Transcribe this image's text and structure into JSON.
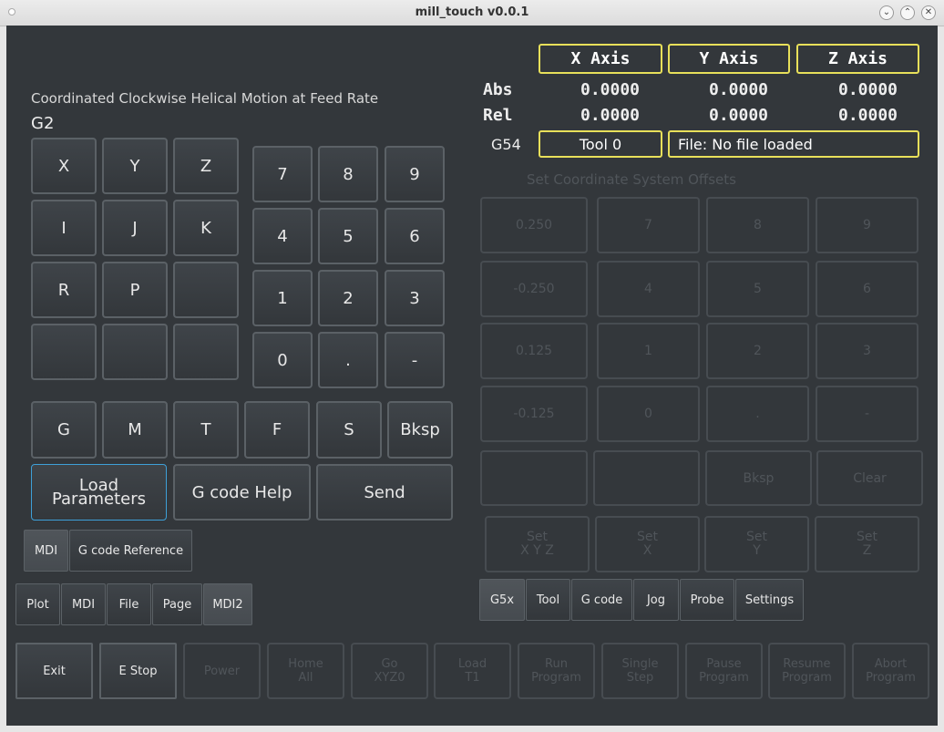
{
  "window": {
    "title": "mill_touch v0.0.1"
  },
  "dro": {
    "headers": [
      "X Axis",
      "Y Axis",
      "Z Axis"
    ],
    "abs_label": "Abs",
    "rel_label": "Rel",
    "abs": [
      "0.0000",
      "0.0000",
      "0.0000"
    ],
    "rel": [
      "0.0000",
      "0.0000",
      "0.0000"
    ],
    "coord_system": "G54",
    "tool": "Tool 0",
    "file": "File: No file loaded"
  },
  "mdi": {
    "description": "Coordinated Clockwise Helical Motion at Feed Rate",
    "command": "G2",
    "letters": [
      "X",
      "Y",
      "Z",
      "I",
      "J",
      "K",
      "R",
      "P",
      "",
      "",
      "",
      ""
    ],
    "digits": [
      "7",
      "8",
      "9",
      "4",
      "5",
      "6",
      "1",
      "2",
      "3",
      "0",
      ".",
      "-"
    ],
    "codes": [
      "G",
      "M",
      "T",
      "F",
      "S",
      "Bksp"
    ],
    "load_parameters": "Load\nParameters",
    "gcode_help": "G code Help",
    "send": "Send",
    "sub_tabs": [
      "MDI",
      "G code Reference"
    ],
    "main_tabs": [
      "Plot",
      "MDI",
      "File",
      "Page",
      "MDI2"
    ]
  },
  "offsets": {
    "title": "Set Coordinate System Offsets",
    "keys": [
      "0.250",
      "7",
      "8",
      "9",
      "-0.250",
      "4",
      "5",
      "6",
      "0.125",
      "1",
      "2",
      "3",
      "-0.125",
      "0",
      ".",
      "-"
    ],
    "row5": [
      "",
      "",
      "Bksp",
      "Clear"
    ],
    "set_buttons": [
      "Set\nX Y Z",
      "Set\nX",
      "Set\nY",
      "Set\nZ"
    ],
    "tabs": [
      "G5x",
      "Tool",
      "G code",
      "Jog",
      "Probe",
      "Settings"
    ]
  },
  "bottom": [
    "Exit",
    "E Stop",
    "Power",
    "Home\nAll",
    "Go\nXYZ0",
    "Load\nT1",
    "Run\nProgram",
    "Single\nStep",
    "Pause\nProgram",
    "Resume\nProgram",
    "Abort\nProgram"
  ]
}
